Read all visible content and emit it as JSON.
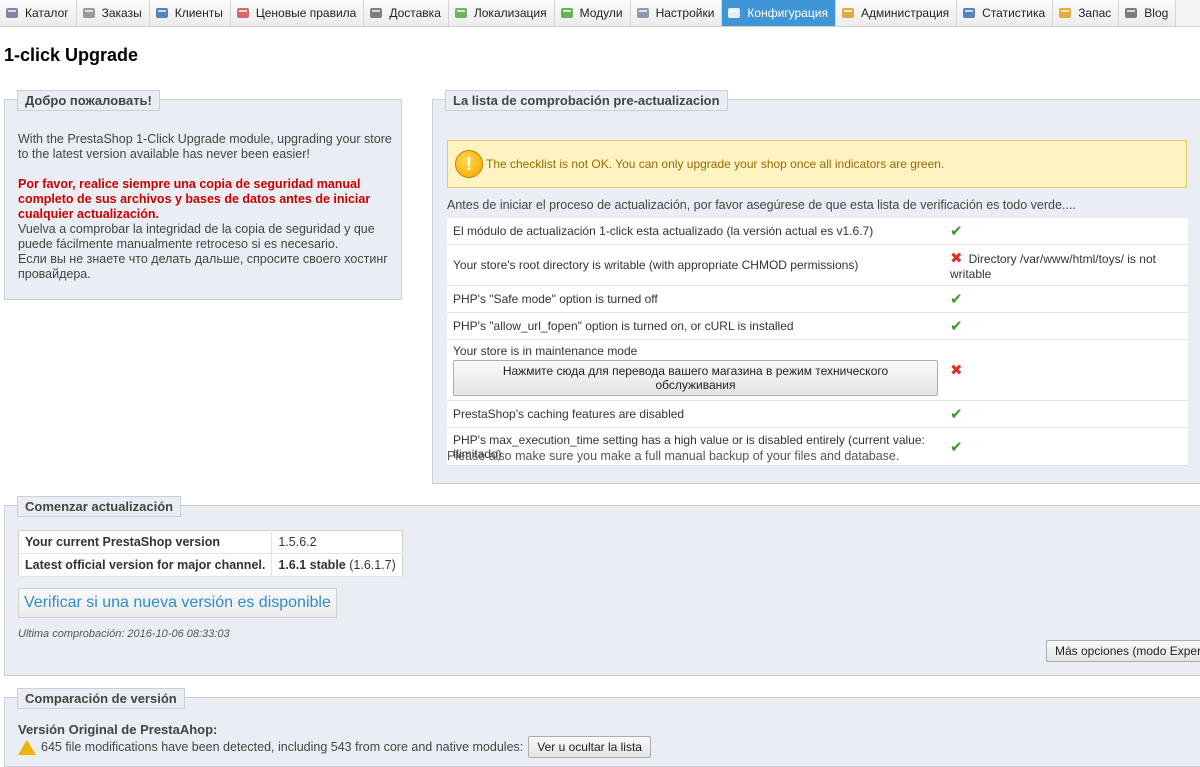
{
  "nav": {
    "tabs": [
      {
        "label": "Каталог",
        "icon": "catalog-icon",
        "color": "#7a6a9a"
      },
      {
        "label": "Заказы",
        "icon": "cart-icon",
        "color": "#8a8a8a"
      },
      {
        "label": "Клиенты",
        "icon": "customers-icon",
        "color": "#3a6fb0"
      },
      {
        "label": "Ценовые правила",
        "icon": "price-rules-icon",
        "color": "#d05050"
      },
      {
        "label": "Доставка",
        "icon": "truck-icon",
        "color": "#6a6a6a"
      },
      {
        "label": "Локализация",
        "icon": "globe-icon",
        "color": "#5aa34a"
      },
      {
        "label": "Модули",
        "icon": "puzzle-icon",
        "color": "#4aa53b"
      },
      {
        "label": "Настройки",
        "icon": "settings-icon",
        "color": "#7a8aa0"
      },
      {
        "label": "Конфигурация",
        "icon": "wrench-icon",
        "color": "#ffffff",
        "active": true
      },
      {
        "label": "Администрация",
        "icon": "key-icon",
        "color": "#d4a020"
      },
      {
        "label": "Статистика",
        "icon": "stats-icon",
        "color": "#3a6fb0"
      },
      {
        "label": "Запас",
        "icon": "stock-icon",
        "color": "#e0a020"
      },
      {
        "label": "Blog",
        "icon": "blog-icon",
        "color": "#666666"
      }
    ]
  },
  "page_title": "1-click Upgrade",
  "welcome": {
    "legend": "Добро пожаловать!",
    "intro": "With the PrestaShop 1-Click Upgrade module, upgrading your store to the latest version available has never been easier!",
    "warning": "Por favor, realice siempre una copia de seguridad manual completo de sus archivos y bases de datos antes de iniciar cualquier actualización.",
    "text1": "Vuelva a comprobar la integridad de la copia de seguridad y que puede fácilmente manualmente retroceso si es necesario.",
    "text2": "Если вы не знаете что делать дальше, спросите своего хостинг провайдера."
  },
  "checklist": {
    "legend": "La lista de comprobación pre-actualizacion",
    "alert": "The checklist is not OK. You can only upgrade your shop once all indicators are green.",
    "intro": "Antes de iniciar el proceso de actualización, por favor asegúrese de que esta lista de verificación es todo verde....",
    "rows": [
      {
        "label": "El módulo de actualización 1-click esta actualizado (la versión actual es v1.6.7)",
        "status": "ok",
        "detail": ""
      },
      {
        "label": "Your store's root directory is writable (with appropriate CHMOD permissions)",
        "status": "bad",
        "detail": "Directory /var/www/html/toys/ is not writable"
      },
      {
        "label": "PHP's \"Safe mode\" option is turned off",
        "status": "ok",
        "detail": ""
      },
      {
        "label": "PHP's \"allow_url_fopen\" option is turned on, or cURL is installed",
        "status": "ok",
        "detail": ""
      },
      {
        "label": "Your store is in maintenance mode",
        "status": "bad",
        "detail": "",
        "button": "Нажмите сюда для перевода вашего магазина в режим технического обслуживания"
      },
      {
        "label": "PrestaShop's caching features are disabled",
        "status": "ok",
        "detail": ""
      },
      {
        "label": "PHP's max_execution_time setting has a high value or is disabled entirely (current value: Ilimitado)",
        "status": "ok",
        "detail": ""
      }
    ],
    "note": "Please also make sure you make a full manual backup of your files and database."
  },
  "upgrade": {
    "legend": "Comenzar actualización",
    "current_label": "Your current PrestaShop version",
    "current_value": "1.5.6.2",
    "latest_label": "Latest official version for major channel.",
    "latest_value": "1.6.1 stable",
    "latest_extra": "(1.6.1.7)",
    "check_button": "Verificar si una nueva versión es disponible",
    "last_check": "Ultima comprobación: 2016-10-06 08:33:03",
    "more_options": "Más opciones (modo Experto)"
  },
  "compare": {
    "legend": "Comparación de versión",
    "original": "Versión Original de PrestaAhop:",
    "modifications": "645 file modifications have been detected, including 543 from core and native modules:",
    "toggle_button": "Ver u ocultar la lista"
  }
}
